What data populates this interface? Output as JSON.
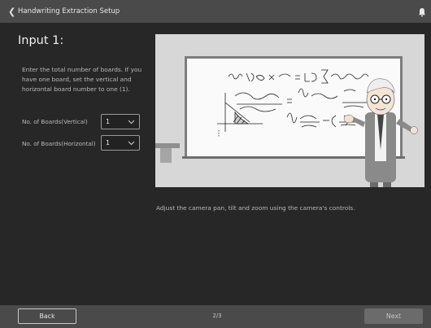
{
  "header": {
    "title": "Handwriting Extraction Setup",
    "back_icon": "chevron-left-icon",
    "bell_icon": "bell-icon"
  },
  "main": {
    "heading": "Input 1:",
    "instruction": "Enter the total number of boards. If you have one board, set the vertical and horizontal board number to one (1).",
    "fields": [
      {
        "label": "No. of Boards(Vertical)",
        "value": "1"
      },
      {
        "label": "No. of Boards(Horizontal)",
        "value": "1"
      }
    ],
    "caption": "Adjust the camera pan, tilt and zoom using the camera's controls."
  },
  "footer": {
    "back_label": "Back",
    "page_indicator": "2/3",
    "next_label": "Next"
  },
  "colors": {
    "background": "#272727",
    "bar": "#4a4a4a",
    "illustration_bg": "#d7d7d7",
    "next_disabled": "#6b6b6b"
  }
}
